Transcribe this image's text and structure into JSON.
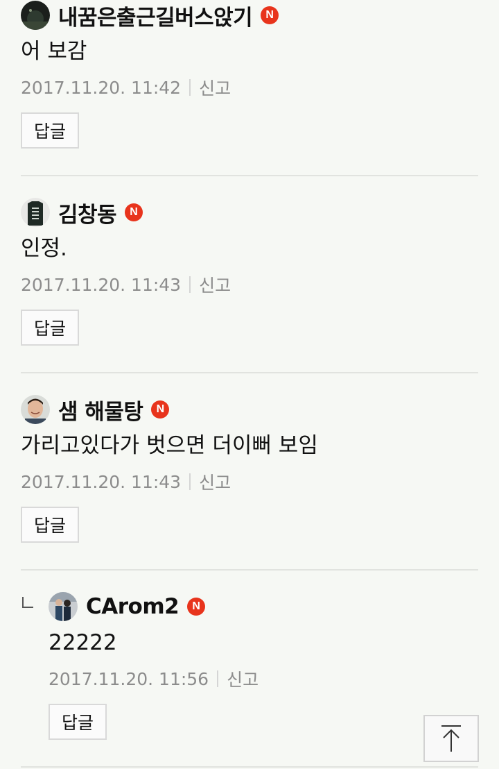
{
  "comments": [
    {
      "author": "내꿈은출근길버스앉기",
      "badge": "N",
      "text": "어 보감",
      "date": "2017.11.20. 11:42",
      "report": "신고",
      "reply_label": "답글",
      "avatar_icon": "night-scene-avatar"
    },
    {
      "author": "김창동",
      "badge": "N",
      "text": "인정.",
      "date": "2017.11.20. 11:43",
      "report": "신고",
      "reply_label": "답글",
      "avatar_icon": "tshirt-avatar"
    },
    {
      "author": "샘 해물탕",
      "badge": "N",
      "text": "가리고있다가 벗으면 더이뻐 보임",
      "date": "2017.11.20. 11:43",
      "report": "신고",
      "reply_label": "답글",
      "avatar_icon": "smiling-man-avatar"
    },
    {
      "author": "CArom2",
      "badge": "N",
      "text": "22222",
      "date": "2017.11.20. 11:56",
      "report": "신고",
      "reply_label": "답글",
      "avatar_icon": "couple-photo-avatar",
      "is_reply": true
    }
  ],
  "colors": {
    "badge": "#e8341c",
    "meta_text": "#8c8c8c",
    "background": "#f6f8f4"
  },
  "scroll_top_icon": "arrow-up-to-top-icon"
}
